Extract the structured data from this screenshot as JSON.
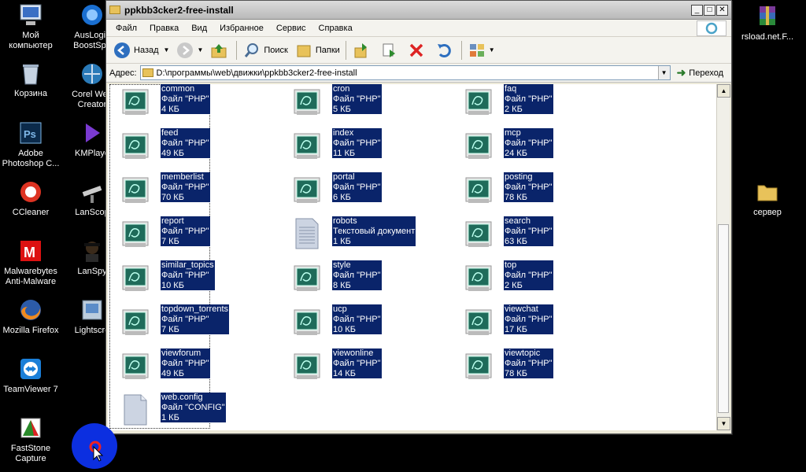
{
  "desktop": {
    "left_icons": [
      {
        "label": "Мой компьютер",
        "icon": "computer-icon"
      },
      {
        "label": "Корзина",
        "icon": "recycle-bin-icon"
      },
      {
        "label": "Adobe Photoshop C...",
        "icon": "photoshop-icon"
      },
      {
        "label": "CCleaner",
        "icon": "ccleaner-icon"
      },
      {
        "label": "Malwarebytes Anti-Malware",
        "icon": "malwarebytes-icon"
      },
      {
        "label": "Mozilla Firefox",
        "icon": "firefox-icon"
      },
      {
        "label": "TeamViewer 7",
        "icon": "teamviewer-icon"
      },
      {
        "label": "FastStone Capture",
        "icon": "faststone-icon"
      }
    ],
    "second_col_icons": [
      {
        "label": "AusLogic BoostSpe",
        "icon": "auslogics-icon"
      },
      {
        "label": "Corel Web Creator",
        "icon": "corel-icon"
      },
      {
        "label": "KMPlaye",
        "icon": "kmplayer-icon"
      },
      {
        "label": "LanScop",
        "icon": "lanscope-icon"
      },
      {
        "label": "LanSpy",
        "icon": "lanspy-icon"
      },
      {
        "label": "Lightscre",
        "icon": "lightscreen-icon"
      }
    ],
    "right_icons": [
      {
        "label": "rsload.net.F...",
        "icon": "winrar-icon"
      },
      {
        "label": "сервер",
        "icon": "folder-icon"
      }
    ]
  },
  "window": {
    "title": "ppkbb3cker2-free-install",
    "menu": [
      "Файл",
      "Правка",
      "Вид",
      "Избранное",
      "Сервис",
      "Справка"
    ],
    "toolbar": {
      "back": "Назад",
      "search": "Поиск",
      "folders": "Папки"
    },
    "address": {
      "label": "Адрес:",
      "path": "D:\\программы\\web\\движки\\ppkbb3cker2-free-install",
      "go": "Переход"
    }
  },
  "files": [
    [
      {
        "name": "common",
        "type": "Файл \"PHP\"",
        "size": "4 КБ",
        "kind": "php"
      },
      {
        "name": "feed",
        "type": "Файл \"PHP\"",
        "size": "49 КБ",
        "kind": "php"
      },
      {
        "name": "memberlist",
        "type": "Файл \"PHP\"",
        "size": "70 КБ",
        "kind": "php"
      },
      {
        "name": "report",
        "type": "Файл \"PHP\"",
        "size": "7 КБ",
        "kind": "php"
      },
      {
        "name": "similar_topics",
        "type": "Файл \"PHP\"",
        "size": "10 КБ",
        "kind": "php"
      },
      {
        "name": "topdown_torrents",
        "type": "Файл \"PHP\"",
        "size": "7 КБ",
        "kind": "php"
      },
      {
        "name": "viewforum",
        "type": "Файл \"PHP\"",
        "size": "49 КБ",
        "kind": "php"
      },
      {
        "name": "web.config",
        "type": "Файл \"CONFIG\"",
        "size": "1 КБ",
        "kind": "generic"
      }
    ],
    [
      {
        "name": "cron",
        "type": "Файл \"PHP\"",
        "size": "5 КБ",
        "kind": "php"
      },
      {
        "name": "index",
        "type": "Файл \"PHP\"",
        "size": "11 КБ",
        "kind": "php"
      },
      {
        "name": "portal",
        "type": "Файл \"PHP\"",
        "size": "6 КБ",
        "kind": "php"
      },
      {
        "name": "robots",
        "type": "Текстовый документ",
        "size": "1 КБ",
        "kind": "text"
      },
      {
        "name": "style",
        "type": "Файл \"PHP\"",
        "size": "8 КБ",
        "kind": "php"
      },
      {
        "name": "ucp",
        "type": "Файл \"PHP\"",
        "size": "10 КБ",
        "kind": "php"
      },
      {
        "name": "viewonline",
        "type": "Файл \"PHP\"",
        "size": "14 КБ",
        "kind": "php"
      }
    ],
    [
      {
        "name": "faq",
        "type": "Файл \"PHP\"",
        "size": "2 КБ",
        "kind": "php"
      },
      {
        "name": "mcp",
        "type": "Файл \"PHP\"",
        "size": "24 КБ",
        "kind": "php"
      },
      {
        "name": "posting",
        "type": "Файл \"PHP\"",
        "size": "78 КБ",
        "kind": "php"
      },
      {
        "name": "search",
        "type": "Файл \"PHP\"",
        "size": "63 КБ",
        "kind": "php"
      },
      {
        "name": "top",
        "type": "Файл \"PHP\"",
        "size": "2 КБ",
        "kind": "php"
      },
      {
        "name": "viewchat",
        "type": "Файл \"PHP\"",
        "size": "17 КБ",
        "kind": "php"
      },
      {
        "name": "viewtopic",
        "type": "Файл \"PHP\"",
        "size": "78 КБ",
        "kind": "php"
      }
    ]
  ],
  "colors": {
    "selection": "#0a246a",
    "desktop": "#000000"
  }
}
